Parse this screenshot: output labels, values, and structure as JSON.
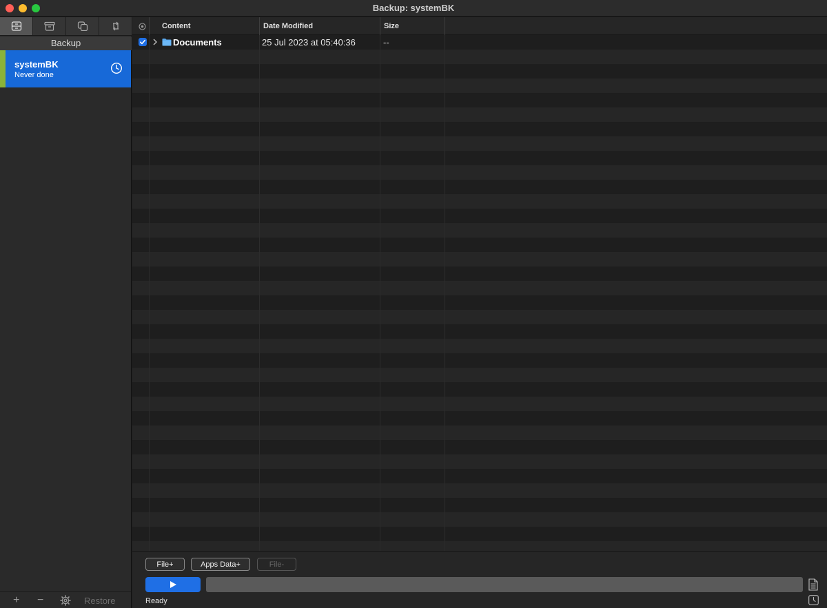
{
  "window": {
    "title": "Backup: systemBK"
  },
  "sidebar": {
    "section_label": "Backup",
    "modes": [
      {
        "icon": "backup-drive-icon",
        "active": true
      },
      {
        "icon": "archive-box-icon",
        "active": false
      },
      {
        "icon": "copy-squares-icon",
        "active": false
      },
      {
        "icon": "sync-arrows-icon",
        "active": false
      }
    ],
    "job": {
      "name": "systemBK",
      "status": "Never done",
      "icon": "clock-icon",
      "accent_color": "#8ab33a",
      "bg_color": "#1769d8"
    },
    "footer": {
      "add": "+",
      "remove": "−",
      "settings_icon": "gear-icon",
      "restore": "Restore"
    }
  },
  "table": {
    "columns": {
      "select_icon": "column-options-icon",
      "content": "Content",
      "date": "Date Modified",
      "size": "Size"
    },
    "rows": [
      {
        "checked": true,
        "name": "Documents",
        "date": "25 Jul 2023 at 05:40:36",
        "size": "--",
        "icon": "folder-icon"
      }
    ]
  },
  "controls": {
    "file_add": "File+",
    "apps_add": "Apps Data+",
    "file_remove": "File-",
    "run_icon": "play-icon",
    "progress": 0,
    "status": "Ready",
    "log_icon": "document-icon",
    "schedule_icon": "clock-icon"
  },
  "colors": {
    "accent": "#1f6fe5"
  }
}
